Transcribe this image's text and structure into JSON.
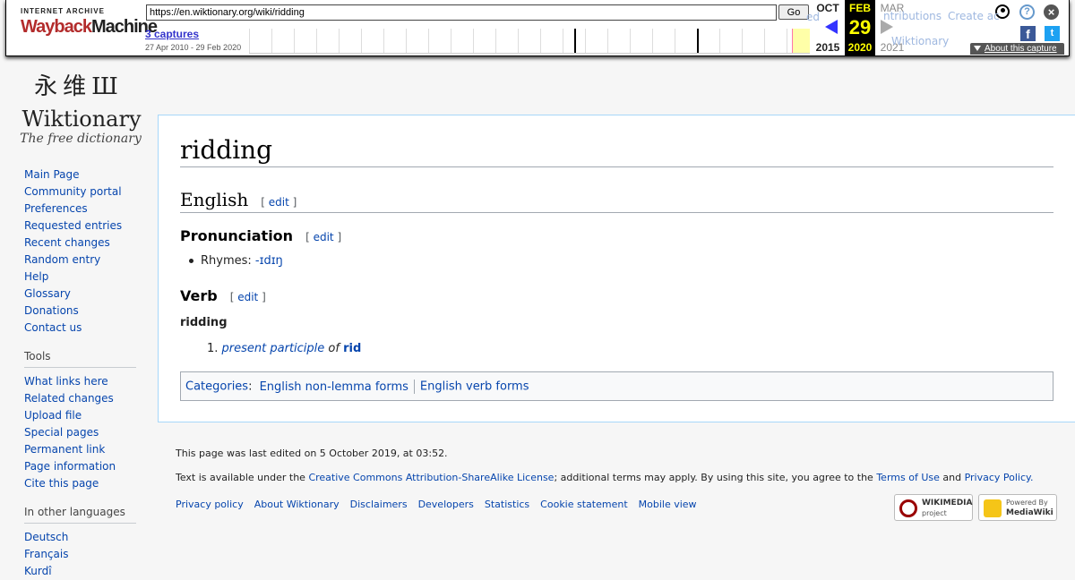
{
  "wayback": {
    "logo_top": "INTERNET ARCHIVE",
    "logo_way": "Wayback",
    "logo_machine": "Machine",
    "url": "https://en.wiktionary.org/wiki/ridding",
    "go_label": "Go",
    "captures": "3 captures",
    "range": "27 Apr 2010 - 29 Feb 2020",
    "prev_month": "OCT",
    "prev_year": "2015",
    "cur_month": "FEB",
    "cur_day": "29",
    "cur_year": "2020",
    "next_month": "MAR",
    "next_year": "2021",
    "about": "About this capture",
    "colors": {
      "current_bg": "#000000",
      "current_fg": "#ffff00",
      "prev_arrow": "#3333ff"
    },
    "icons": [
      "user-icon",
      "help-icon",
      "close-icon",
      "facebook-icon",
      "twitter-icon"
    ]
  },
  "ghost": {
    "contributions": "ntributions",
    "create": "Create ac",
    "wiktionary": "Wiktionary",
    "ed": "ed"
  },
  "logo": {
    "glyphs": "永维Ш",
    "word": "Wiktionary",
    "tagline": "The free dictionary"
  },
  "nav": {
    "main": [
      "Main Page",
      "Community portal",
      "Preferences",
      "Requested entries",
      "Recent changes",
      "Random entry",
      "Help",
      "Glossary",
      "Donations",
      "Contact us"
    ],
    "tools_heading": "Tools",
    "tools": [
      "What links here",
      "Related changes",
      "Upload file",
      "Special pages",
      "Permanent link",
      "Page information",
      "Cite this page"
    ],
    "languages_heading": "In other languages",
    "languages": [
      "Deutsch",
      "Français",
      "Kurdî"
    ]
  },
  "article": {
    "title": "ridding",
    "lang_heading": "English",
    "pron_heading": "Pronunciation",
    "verb_heading": "Verb",
    "edit_open": "[",
    "edit_label": "edit",
    "edit_close": "]",
    "rhymes_label": "Rhymes:",
    "rhymes_value": "-ɪdɪŋ",
    "headword": "ridding",
    "sense_num": "1.",
    "sense_link": "present participle",
    "sense_of": "of",
    "sense_lemma": "rid",
    "categories_label": "Categories",
    "categories": [
      "English non-lemma forms",
      "English verb forms"
    ]
  },
  "footer": {
    "last_edited": "This page was last edited on 5 October 2019, at 03:52.",
    "license_pre": "Text is available under the ",
    "license_link": "Creative Commons Attribution-ShareAlike License",
    "license_mid": "; additional terms may apply. By using this site, you agree to the ",
    "terms_link": "Terms of Use",
    "and": " and ",
    "privacy_link": "Privacy Policy.",
    "places": [
      "Privacy policy",
      "About Wiktionary",
      "Disclaimers",
      "Developers",
      "Statistics",
      "Cookie statement",
      "Mobile view"
    ],
    "badge_wm_1": "WIKIMEDIA",
    "badge_wm_2": "project",
    "badge_mw_1": "Powered By",
    "badge_mw_2": "MediaWiki"
  }
}
